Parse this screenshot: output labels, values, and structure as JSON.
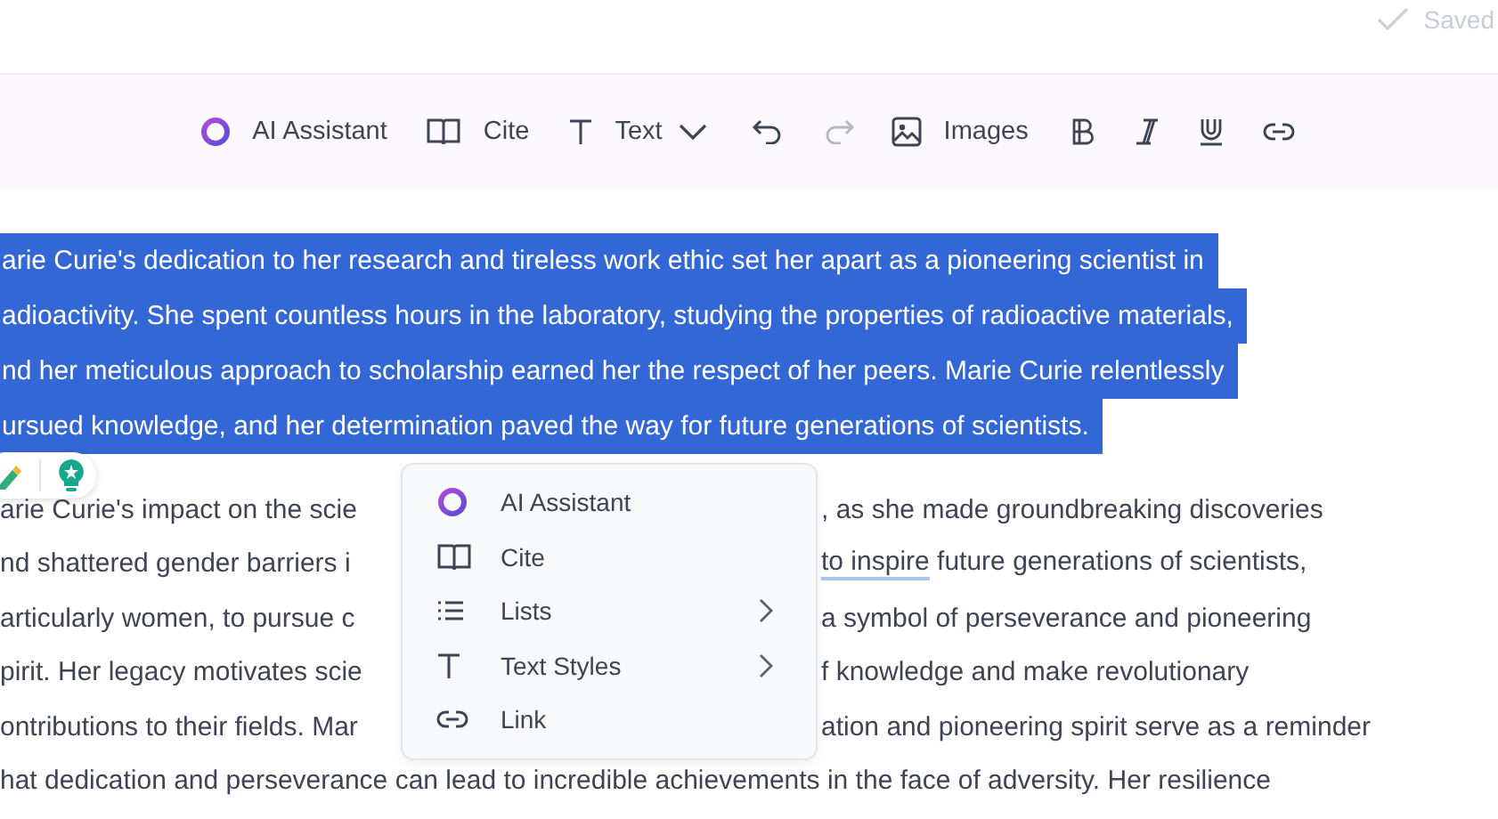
{
  "status": {
    "label": "Saved"
  },
  "toolbar": {
    "ai_assistant": "AI Assistant",
    "cite": "Cite",
    "text_style": "Text",
    "undo": {
      "disabled": false
    },
    "redo": {
      "disabled": true
    },
    "images": "Images"
  },
  "selected_paragraph": {
    "selected": true,
    "lines": [
      "arie Curie's dedication to her research and tireless work ethic set her apart as a pioneering scientist in",
      "adioactivity. She spent countless hours in the laboratory, studying the properties of radioactive materials,",
      "nd her meticulous approach to scholarship earned her the respect of her peers. Marie Curie relentlessly",
      "ursued knowledge, and her determination paved the way for future generations of scientists."
    ]
  },
  "paragraph": {
    "lines": [
      {
        "left": "arie Curie's impact on the scie",
        "right": [
          {
            "text": ", as she made groundbreaking discoveries",
            "underlined": false
          }
        ]
      },
      {
        "left": "nd shattered gender barriers i",
        "right": [
          {
            "text": "to inspire",
            "underlined": true
          },
          {
            "text": " future generations of scientists,",
            "underlined": false
          }
        ]
      },
      {
        "left": "articularly women, to pursue c",
        "right": [
          {
            "text": "a symbol of perseverance and pioneering",
            "underlined": false
          }
        ]
      },
      {
        "left": "pirit. Her legacy motivates scie",
        "right": [
          {
            "text": "f knowledge and make revolutionary",
            "underlined": false
          }
        ]
      },
      {
        "left": "ontributions to their fields. Mar",
        "right": [
          {
            "text": "ation and pioneering spirit serve as a reminder",
            "underlined": false
          }
        ]
      },
      {
        "left": "hat dedication and perseverance can lead to incredible achievements in the face of adversity. Her resilience"
      }
    ]
  },
  "context_menu": {
    "items": [
      {
        "label": "AI Assistant",
        "has_submenu": false
      },
      {
        "label": "Cite",
        "has_submenu": false
      },
      {
        "label": "Lists",
        "has_submenu": true
      },
      {
        "label": "Text Styles",
        "has_submenu": true
      },
      {
        "label": "Link",
        "has_submenu": false
      }
    ]
  }
}
